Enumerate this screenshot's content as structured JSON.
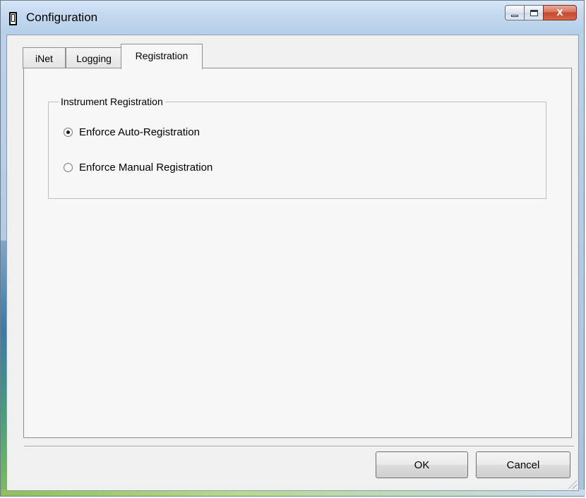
{
  "window": {
    "title": "Configuration",
    "controls": {
      "minimize": "minimize",
      "maximize": "maximize",
      "close": "X"
    }
  },
  "tabs": [
    {
      "label": "iNet",
      "selected": false
    },
    {
      "label": "Logging",
      "selected": false
    },
    {
      "label": "Registration",
      "selected": true
    }
  ],
  "registration": {
    "group_label": "Instrument Registration",
    "options": [
      {
        "label": "Enforce Auto-Registration",
        "checked": true
      },
      {
        "label": "Enforce Manual Registration",
        "checked": false
      }
    ]
  },
  "buttons": {
    "ok": "OK",
    "cancel": "Cancel"
  },
  "icons": {
    "app": "window-icon",
    "minimize": "minimize-icon",
    "maximize": "maximize-icon",
    "close": "close-icon",
    "grip": "resize-grip-icon"
  }
}
